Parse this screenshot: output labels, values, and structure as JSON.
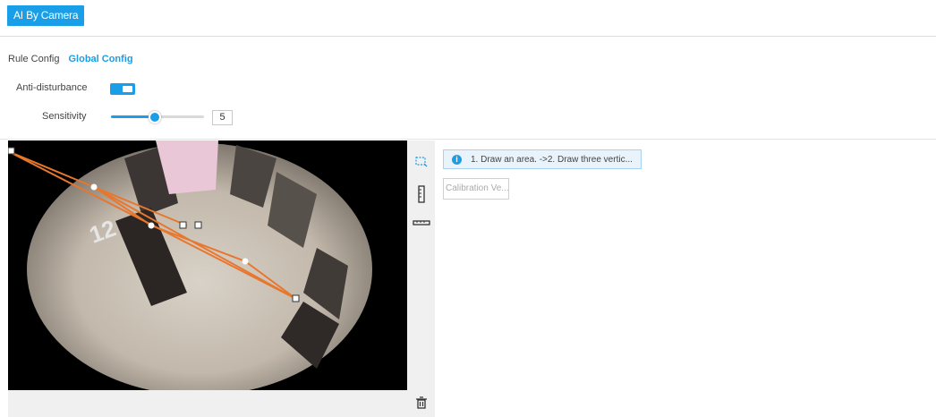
{
  "header": {
    "ai_button_label": "AI By Camera"
  },
  "tabs": [
    {
      "label": "Rule Config",
      "active": false
    },
    {
      "label": "Global Config",
      "active": true
    }
  ],
  "settings": {
    "anti_disturbance_label": "Anti-disturbance",
    "anti_disturbance_on": true,
    "sensitivity_label": "Sensitivity",
    "sensitivity_value": "5",
    "sensitivity_fraction": 0.45
  },
  "tools": [
    "draw-area-icon",
    "vertical-ruler-icon",
    "horizontal-ruler-icon",
    "delete-icon"
  ],
  "panel": {
    "hint_text": "1. Draw an area. ->2. Draw three vertic...",
    "calibration_button_label": "Calibration Ve..."
  },
  "colors": {
    "accent": "#1a9ee8",
    "overlay_line": "#e8772e"
  }
}
